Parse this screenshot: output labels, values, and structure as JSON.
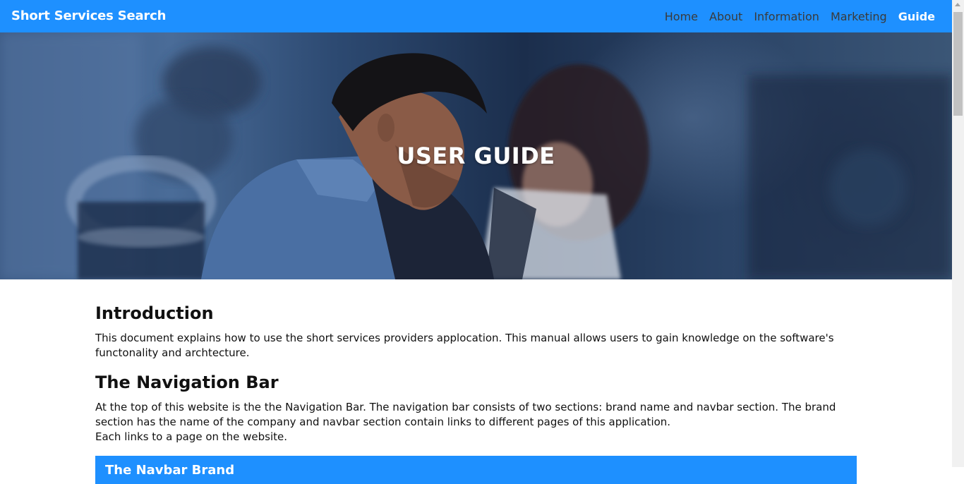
{
  "navbar": {
    "brand": "Short Services Search",
    "links": [
      {
        "label": "Home",
        "active": false
      },
      {
        "label": "About",
        "active": false
      },
      {
        "label": "Information",
        "active": false
      },
      {
        "label": "Marketing",
        "active": false
      },
      {
        "label": "Guide",
        "active": true
      }
    ]
  },
  "hero": {
    "title": "USER GUIDE"
  },
  "sections": {
    "intro": {
      "heading": "Introduction",
      "text": "This document explains how to use the short services providers applocation. This manual allows users to gain knowledge on the software's functonality and archtecture."
    },
    "navbar": {
      "heading": "The Navigation Bar",
      "text": "At the top of this website is the the Navigation Bar. The navigation bar consists of two sections: brand name and navbar section. The brand section has the name of the company and navbar section contain links to different pages of this application.",
      "text2": "Each links to a page on the website."
    }
  },
  "card": {
    "title": "The Navbar Brand"
  },
  "colors": {
    "primary": "#1e90ff",
    "nav_link": "#3a3a3a",
    "nav_active": "#ffffff"
  }
}
